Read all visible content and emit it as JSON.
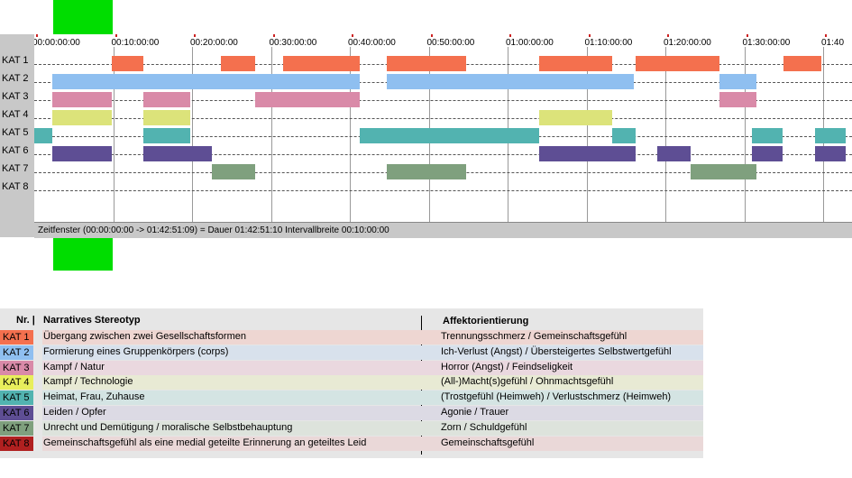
{
  "timeline": {
    "ticks": [
      "00:00:00:00",
      "00:10:00:00",
      "00:20:00:00",
      "00:30:00:00",
      "00:40:00:00",
      "00:50:00:00",
      "01:00:00:00",
      "01:10:00:00",
      "01:20:00:00",
      "01:30:00:00",
      "01:40"
    ],
    "total_minutes": 102.85,
    "status": "Zeitfenster (00:00:00:00 -> 01:42:51:09) = Dauer 01:42:51:10     Intervallbreite 00:10:00:00",
    "rows": [
      {
        "label": "KAT 1",
        "color": "#f4704e",
        "segments": [
          [
            9.8,
            13.8
          ],
          [
            23.7,
            28.0
          ],
          [
            31.5,
            41.3
          ],
          [
            44.7,
            54.7
          ],
          [
            64.0,
            73.2
          ],
          [
            76.2,
            86.8
          ],
          [
            95.0,
            99.8
          ]
        ]
      },
      {
        "label": "KAT 2",
        "color": "#8fbff0",
        "segments": [
          [
            2.3,
            41.3
          ],
          [
            44.7,
            76.0
          ],
          [
            86.8,
            91.5
          ]
        ]
      },
      {
        "label": "KAT 3",
        "color": "#d98aa8",
        "segments": [
          [
            2.3,
            9.8
          ],
          [
            13.8,
            19.8
          ],
          [
            28.0,
            41.3
          ],
          [
            86.8,
            91.5
          ]
        ]
      },
      {
        "label": "KAT 4",
        "color": "#dce37a",
        "segments": [
          [
            2.3,
            9.8
          ],
          [
            13.8,
            19.8
          ],
          [
            64.0,
            73.2
          ]
        ]
      },
      {
        "label": "KAT 5",
        "color": "#52b3b0",
        "segments": [
          [
            0,
            2.3
          ],
          [
            13.8,
            19.8
          ],
          [
            41.3,
            64.0
          ],
          [
            73.2,
            76.2
          ],
          [
            91.0,
            94.8
          ],
          [
            99.0,
            102.85
          ]
        ]
      },
      {
        "label": "KAT 6",
        "color": "#5e4e94",
        "segments": [
          [
            2.3,
            9.8
          ],
          [
            13.8,
            22.5
          ],
          [
            64.0,
            76.2
          ],
          [
            79.0,
            83.2
          ],
          [
            91.0,
            94.8
          ],
          [
            99.0,
            102.85
          ]
        ]
      },
      {
        "label": "KAT 7",
        "color": "#7fa07e",
        "segments": [
          [
            22.5,
            28.0
          ],
          [
            44.7,
            54.7
          ],
          [
            83.2,
            91.5
          ]
        ]
      },
      {
        "label": "KAT 8",
        "color": "#b02020",
        "segments": []
      }
    ]
  },
  "legend": {
    "col_nr": "Nr. |",
    "col_stereotyp": "Narratives Stereotyp",
    "col_affekt": "Affektorientierung",
    "rows": [
      {
        "badge": "KAT 1",
        "badge_color": "#f4704e",
        "stripe_color": "#eed6d2",
        "stereotyp": "Übergang zwischen zwei Gesellschaftsformen",
        "affekt": "Trennungsschmerz / Gemeinschaftsgefühl"
      },
      {
        "badge": "KAT 2",
        "badge_color": "#8fbff0",
        "stripe_color": "#d8e1ec",
        "stereotyp": "Formierung eines Gruppenkörpers (corps)",
        "affekt": "Ich-Verlust (Angst) / Übersteigertes Selbstwertgefühl"
      },
      {
        "badge": "KAT 3",
        "badge_color": "#d98aa8",
        "stripe_color": "#ead8df",
        "stereotyp": "Kampf / Natur",
        "affekt": "Horror (Angst) / Feindseligkeit"
      },
      {
        "badge": "KAT 4",
        "badge_color": "#e8ee5c",
        "stripe_color": "#e8ead4",
        "stereotyp": "Kampf / Technologie",
        "affekt": "(All-)Macht(s)gefühl / Ohnmachtsgefühl"
      },
      {
        "badge": "KAT 5",
        "badge_color": "#52b3b0",
        "stripe_color": "#d4e4e3",
        "stereotyp": "Heimat, Frau, Zuhause",
        "affekt": "(Trostgefühl (Heimweh) / Verlustschmerz (Heimweh)"
      },
      {
        "badge": "KAT 6",
        "badge_color": "#5e4e94",
        "stripe_color": "#dcdae4",
        "stereotyp": "Leiden / Opfer",
        "affekt": "Agonie / Trauer"
      },
      {
        "badge": "KAT 7",
        "badge_color": "#7fa07e",
        "stripe_color": "#dde3dc",
        "stereotyp": "Unrecht und Demütigung / moralische Selbstbehauptung",
        "affekt": "Zorn / Schuldgefühl"
      },
      {
        "badge": "KAT 8",
        "badge_color": "#b02020",
        "stripe_color": "#ead8d8",
        "stereotyp": "Gemeinschaftsgefühl als eine medial geteilte Erinnerung an geteiltes Leid",
        "affekt": "Gemeinschaftsgefühl"
      }
    ]
  }
}
